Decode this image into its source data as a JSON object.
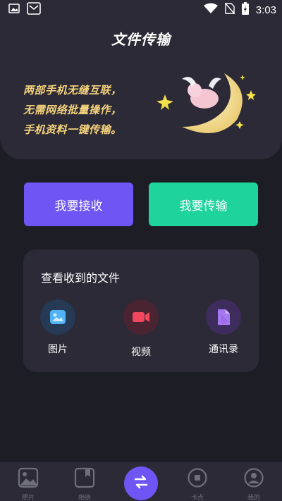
{
  "status_bar": {
    "time": "3:03",
    "icons": [
      "image-icon",
      "mail-icon",
      "wifi-icon",
      "no-sim-icon",
      "battery-charging-icon"
    ]
  },
  "header": {
    "title": "文件传输",
    "slogan_lines": [
      "两部手机无缝互联，",
      "无需网络批量操作，",
      "手机资料一键传输。"
    ],
    "illustration": "moon-pig-illustration"
  },
  "actions": {
    "receive_label": "我要接收",
    "transfer_label": "我要传输",
    "receive_color": "#6f56f4",
    "transfer_color": "#1ed49b"
  },
  "received_files": {
    "title": "查看收到的文件",
    "categories": [
      {
        "label": "图片",
        "icon": "image-icon",
        "color": "#4fb3f5"
      },
      {
        "label": "视频",
        "icon": "video-camera-icon",
        "color": "#f2485e"
      },
      {
        "label": "通讯录",
        "icon": "contacts-file-icon",
        "color": "#a779f0"
      }
    ]
  },
  "bottom_nav": {
    "items": [
      {
        "label": "照片",
        "icon": "photo-icon"
      },
      {
        "label": "相册",
        "icon": "album-icon"
      },
      {
        "label": "",
        "icon": "transfer-arrows-icon"
      },
      {
        "label": "卡点",
        "icon": "record-icon"
      },
      {
        "label": "我的",
        "icon": "profile-icon"
      }
    ]
  }
}
